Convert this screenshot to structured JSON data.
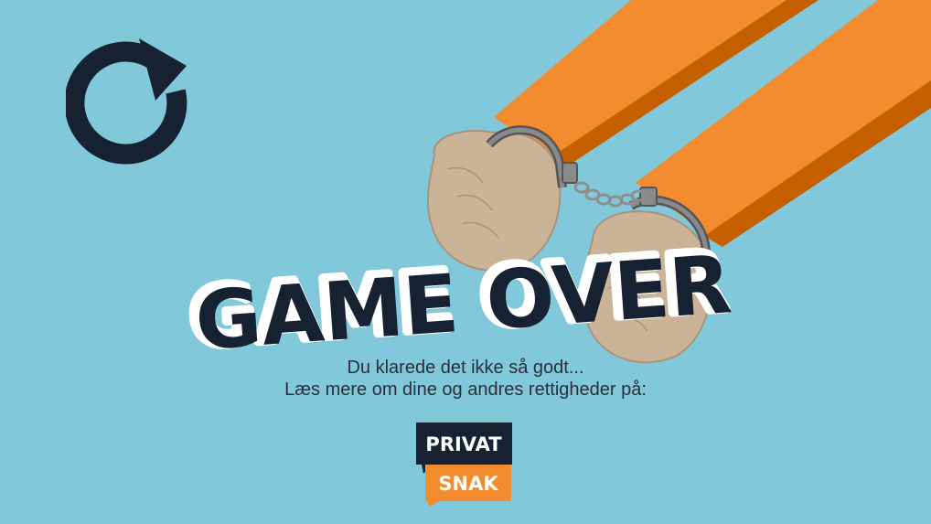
{
  "screen": {
    "title": "GAME OVER",
    "line1": "Du klarede det ikke så godt...",
    "line2": "Læs mere om dine og andres rettigheder på:"
  },
  "logo": {
    "top_word": "PRIVAT",
    "bottom_word": "SNAK"
  },
  "colors": {
    "background": "#82c8db",
    "dark_navy": "#162232",
    "orange": "#f28c2e",
    "orange_shadow": "#c55f00",
    "skin": "#cbb398",
    "metal": "#8a8a8a"
  },
  "icons": {
    "restart": "restart-icon"
  }
}
